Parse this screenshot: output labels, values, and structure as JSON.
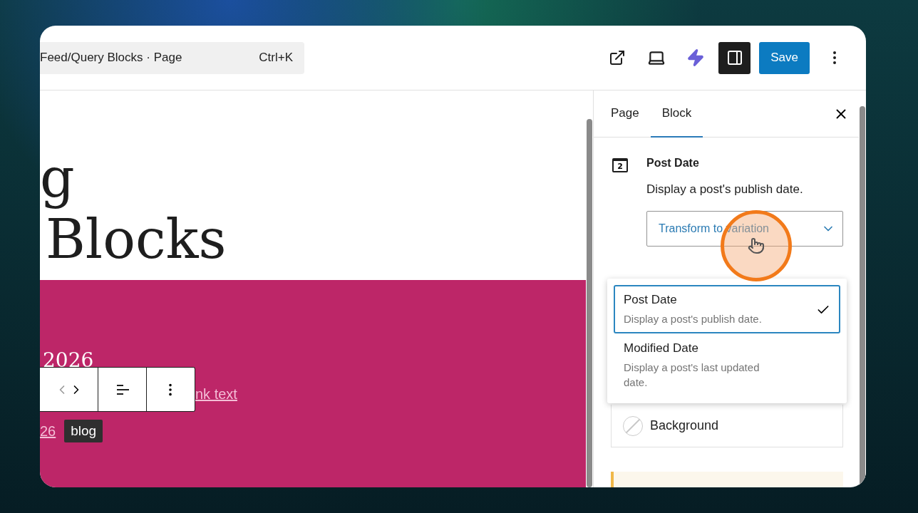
{
  "topbar": {
    "command": {
      "label": "Feed/Query Blocks · Page",
      "shortcut": "Ctrl+K"
    },
    "sidebar_toggle": {
      "on": true
    },
    "save": "Save"
  },
  "canvas": {
    "heading_lines": [
      "g",
      "Blocks"
    ],
    "cover": {
      "date": "2026",
      "link": "nk text",
      "date_link": "26",
      "tag": "blog"
    }
  },
  "sidebar": {
    "tabs": [
      {
        "label": "Page",
        "selected": false
      },
      {
        "label": "Block",
        "selected": true
      }
    ],
    "block": {
      "icon_label": "2",
      "title": "Post Date",
      "description": "Display a post's publish date."
    },
    "variation_select": {
      "label": "Transform to variation",
      "expanded": true
    },
    "variations": [
      {
        "title": "Post Date",
        "description": "Display a post's publish date.",
        "selected": true
      },
      {
        "title": "Modified Date",
        "description": "Display a post's last updated date.",
        "selected": false
      }
    ],
    "color": {
      "label": "Background"
    }
  }
}
